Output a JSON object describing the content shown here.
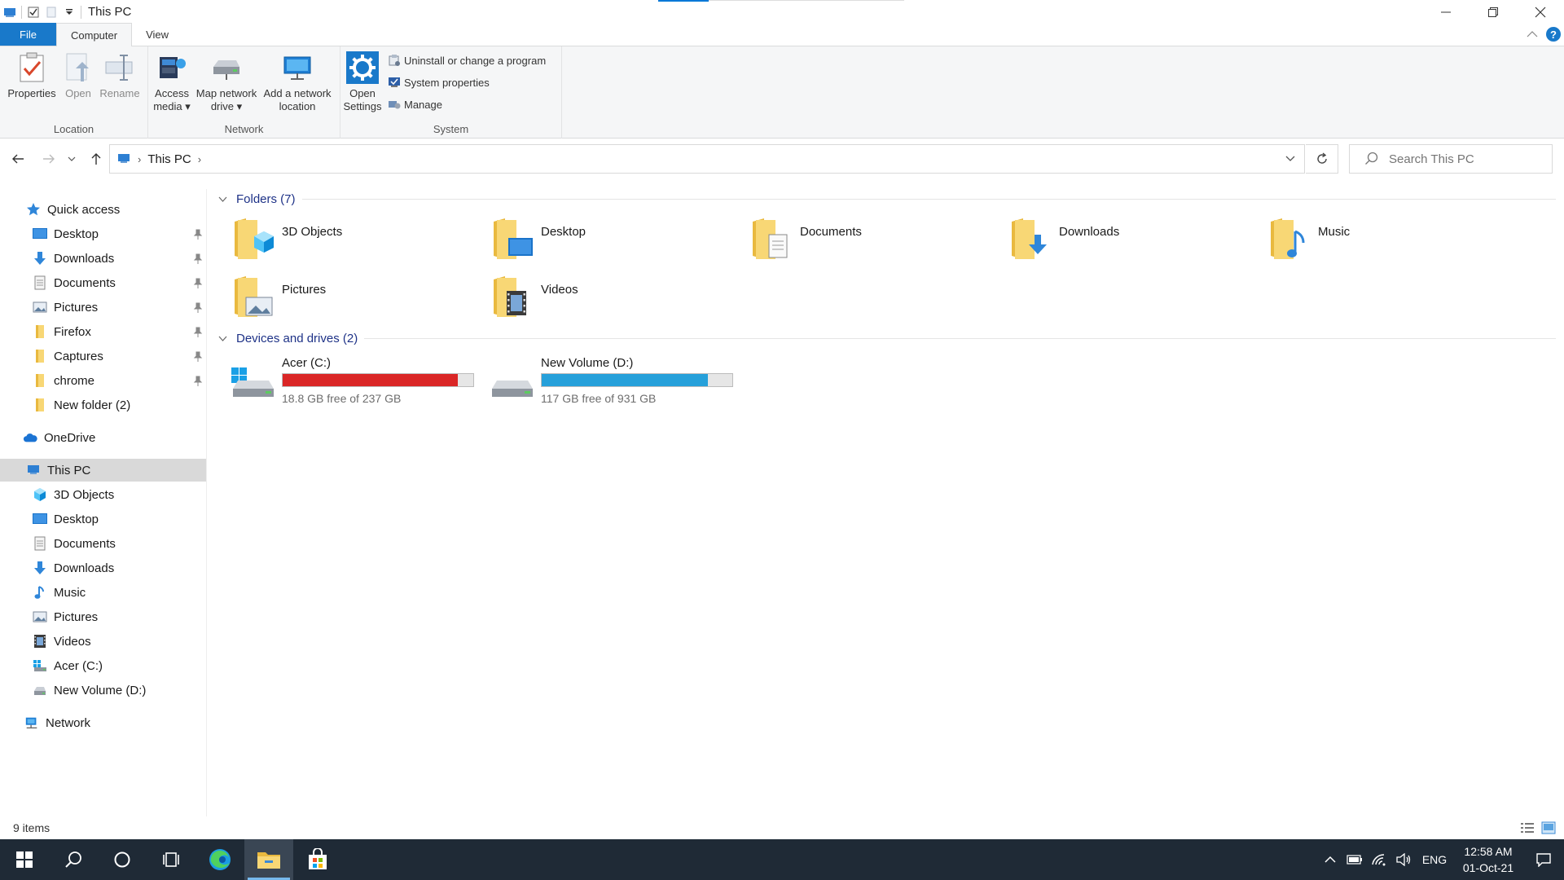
{
  "window": {
    "title": "This PC"
  },
  "ribbon": {
    "tabs": [
      {
        "label": "File"
      },
      {
        "label": "Computer"
      },
      {
        "label": "View"
      }
    ],
    "groups": {
      "location": {
        "label": "Location",
        "properties": "Properties",
        "open": "Open",
        "rename": "Rename"
      },
      "network": {
        "label": "Network",
        "access_media_1": "Access",
        "access_media_2": "media",
        "map_drive_1": "Map network",
        "map_drive_2": "drive",
        "add_location_1": "Add a network",
        "add_location_2": "location"
      },
      "system": {
        "label": "System",
        "open_settings_1": "Open",
        "open_settings_2": "Settings",
        "uninstall": "Uninstall or change a program",
        "system_properties": "System properties",
        "manage": "Manage"
      }
    }
  },
  "address": {
    "crumb": "This PC",
    "search_placeholder": "Search This PC"
  },
  "sidebar": {
    "quick_access": "Quick access",
    "quick_items": [
      {
        "label": "Desktop"
      },
      {
        "label": "Downloads"
      },
      {
        "label": "Documents"
      },
      {
        "label": "Pictures"
      },
      {
        "label": "Firefox"
      },
      {
        "label": "Captures"
      },
      {
        "label": "chrome"
      },
      {
        "label": "New folder (2)"
      }
    ],
    "onedrive": "OneDrive",
    "this_pc": "This PC",
    "pc_items": [
      {
        "label": "3D Objects"
      },
      {
        "label": "Desktop"
      },
      {
        "label": "Documents"
      },
      {
        "label": "Downloads"
      },
      {
        "label": "Music"
      },
      {
        "label": "Pictures"
      },
      {
        "label": "Videos"
      },
      {
        "label": "Acer (C:)"
      },
      {
        "label": "New Volume (D:)"
      }
    ],
    "network": "Network"
  },
  "content": {
    "folders_header": "Folders (7)",
    "folders": [
      {
        "label": "3D Objects"
      },
      {
        "label": "Desktop"
      },
      {
        "label": "Documents"
      },
      {
        "label": "Downloads"
      },
      {
        "label": "Music"
      },
      {
        "label": "Pictures"
      },
      {
        "label": "Videos"
      }
    ],
    "drives_header": "Devices and drives (2)",
    "drives": [
      {
        "name": "Acer (C:)",
        "free": "18.8 GB free of 237 GB",
        "used_fraction": 0.92,
        "color": "#da2626"
      },
      {
        "name": "New Volume (D:)",
        "free": "117 GB free of 931 GB",
        "used_fraction": 0.87,
        "color": "#26a0da"
      }
    ]
  },
  "status": {
    "items": "9 items"
  },
  "taskbar": {
    "lang": "ENG",
    "time": "12:58 AM",
    "date": "01-Oct-21"
  }
}
